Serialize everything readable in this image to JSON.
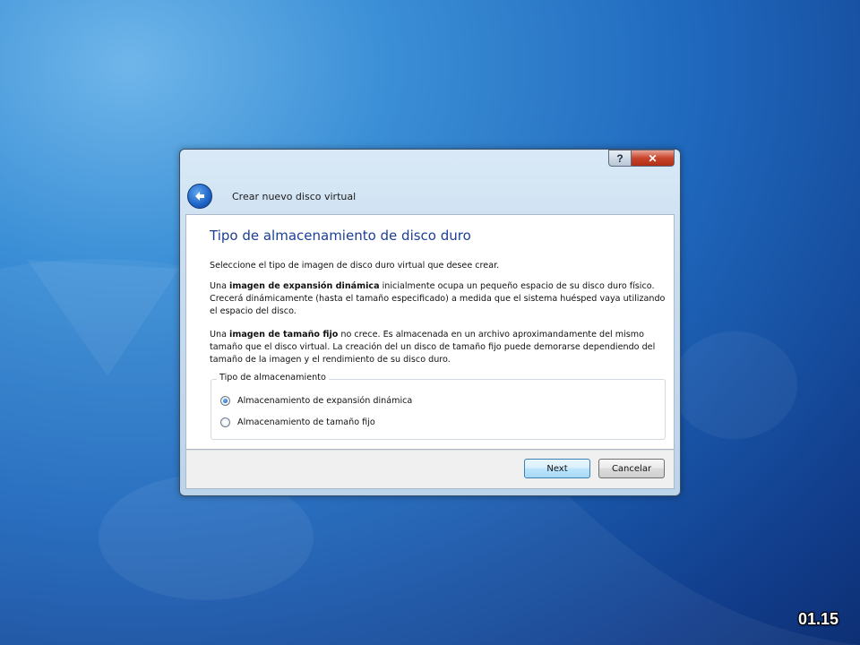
{
  "slide_number": "01.15",
  "window": {
    "title": "Crear nuevo disco virtual",
    "help_label": "?",
    "close_label": "✕"
  },
  "page": {
    "title": "Tipo de almacenamiento de disco duro",
    "intro": "Seleccione el tipo de imagen de disco duro virtual que desee crear.",
    "dynamic_prefix": "Una ",
    "dynamic_bold": "imagen de expansión dinámica",
    "dynamic_rest": " inicialmente ocupa un pequeño espacio de su disco duro físico. Crecerá dinámicamente (hasta el tamaño especificado) a medida que el sistema huésped vaya utilizando el espacio del disco.",
    "fixed_prefix": "Una ",
    "fixed_bold": "imagen de tamaño fijo",
    "fixed_rest": " no crece. Es almacenada en un archivo aproximandamente del mismo tamaño que el disco virtual. La creación del un disco de tamaño fijo puede demorarse dependiendo del tamaño de la imagen y el rendimiento de su disco duro."
  },
  "storage_group": {
    "legend": "Tipo de almacenamiento",
    "options": [
      {
        "label": "Almacenamiento de expansión dinámica",
        "selected": true
      },
      {
        "label": "Almacenamiento de tamaño fijo",
        "selected": false
      }
    ]
  },
  "buttons": {
    "next": "Next",
    "cancel": "Cancelar"
  }
}
